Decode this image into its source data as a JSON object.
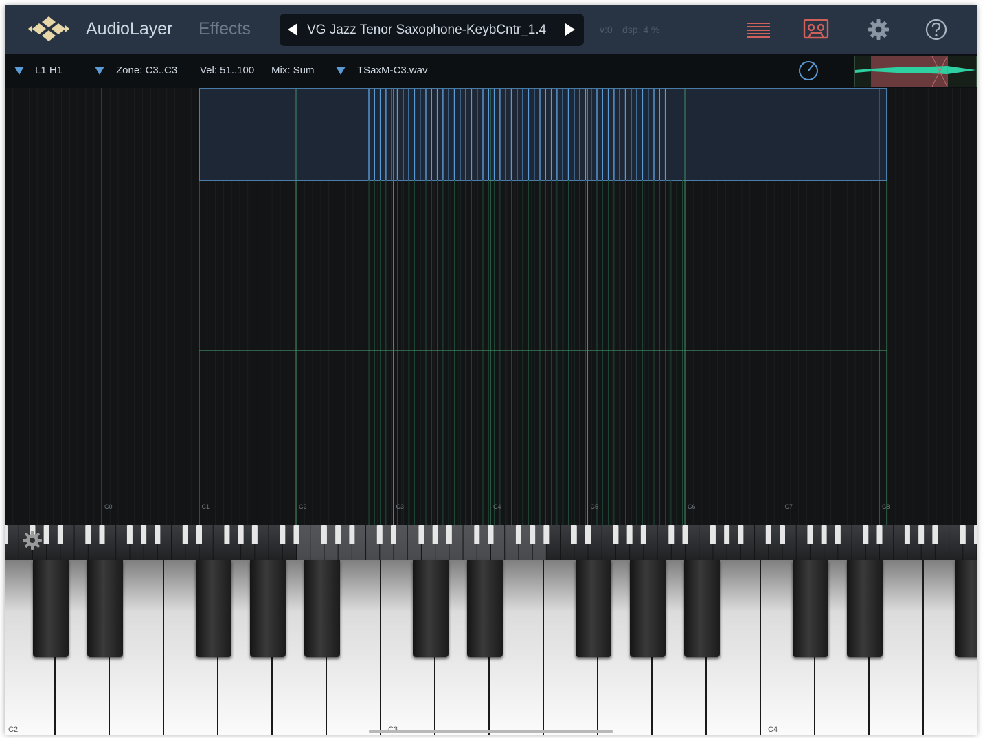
{
  "app": {
    "title": "AudioLayer",
    "effects_tab": "Effects"
  },
  "preset": {
    "name": "VG Jazz Tenor Saxophone-KeybCntr_1.4",
    "prev_icon": "triangle-left-icon",
    "next_icon": "triangle-right-icon"
  },
  "status": {
    "voices": "v:0",
    "dsp": "dsp: 4 %"
  },
  "toolbar_icons": [
    "list-menu-icon",
    "tape-recorder-icon",
    "gear-icon",
    "help-icon"
  ],
  "colors": {
    "topbar_bg": "#283444",
    "accent_blue": "#5b9bd5",
    "icon_red": "#d0605a",
    "grid_green": "#3f8f65",
    "zone_fill": "#1e2735"
  },
  "subbar": {
    "layer": "L1 H1",
    "zone": "Zone: C3..C3",
    "velocity": "Vel: 51..100",
    "mix": "Mix: Sum",
    "sample": "TSaxM-C3.wav"
  },
  "grid": {
    "octave_labels": [
      "C0",
      "C1",
      "C2",
      "C3",
      "C4",
      "C5",
      "C6",
      "C7",
      "C8"
    ]
  },
  "keyboard": {
    "labels": [
      "C2",
      "C3",
      "C4"
    ]
  }
}
